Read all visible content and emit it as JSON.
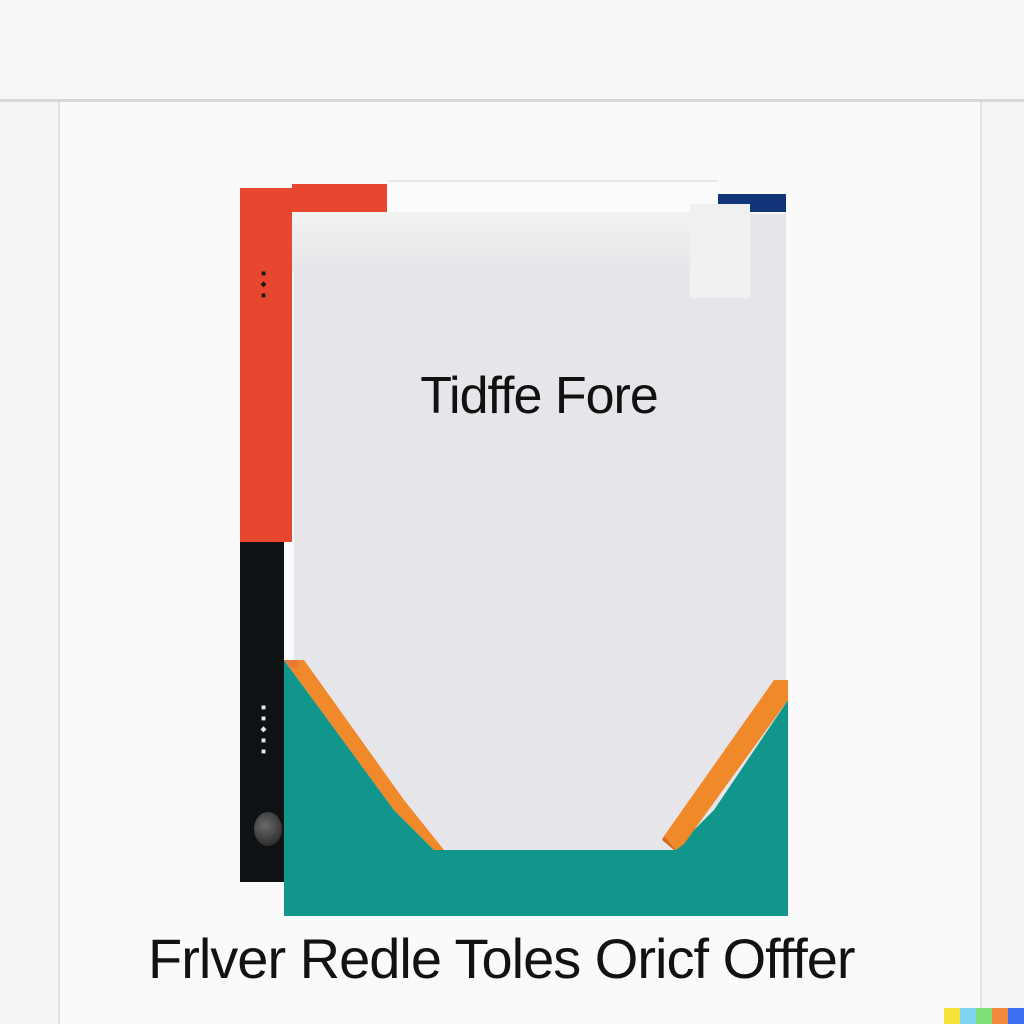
{
  "cover": {
    "title": "Tidffe Fore"
  },
  "caption": {
    "text": "Frlver Redle Toles Oricf Offfer"
  },
  "colors": {
    "spine_red": "#e8462e",
    "spine_black": "#0f1214",
    "navy_tab": "#12357a",
    "teal": "#11968c",
    "orange": "#f0892a",
    "cover": "#e6e6ea"
  },
  "signature": [
    "#f5e33c",
    "#7fd3f0",
    "#7fe07a",
    "#f08a3a",
    "#3c6ef0"
  ]
}
